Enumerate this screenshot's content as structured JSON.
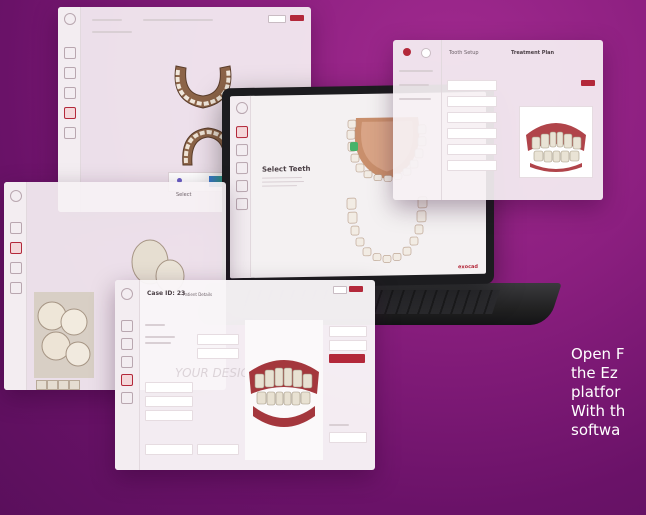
{
  "laptop": {
    "select_teeth_title": "Select Teeth",
    "brand": "exocad"
  },
  "back_panel": {
    "dropdown_label": "Select"
  },
  "right_panel": {
    "title": "Treatment Plan",
    "panel_label": "Tooth Setup"
  },
  "front_panel": {
    "title": "Case ID: 23",
    "subtitle": "Patient Details",
    "watermark": "YOUR DESIGN"
  },
  "caption": {
    "lines": [
      "Open F",
      "the Ez",
      "platfor",
      "With th",
      "softwa"
    ]
  },
  "colors": {
    "accent": "#b3283a",
    "background": "#8c1f80"
  }
}
